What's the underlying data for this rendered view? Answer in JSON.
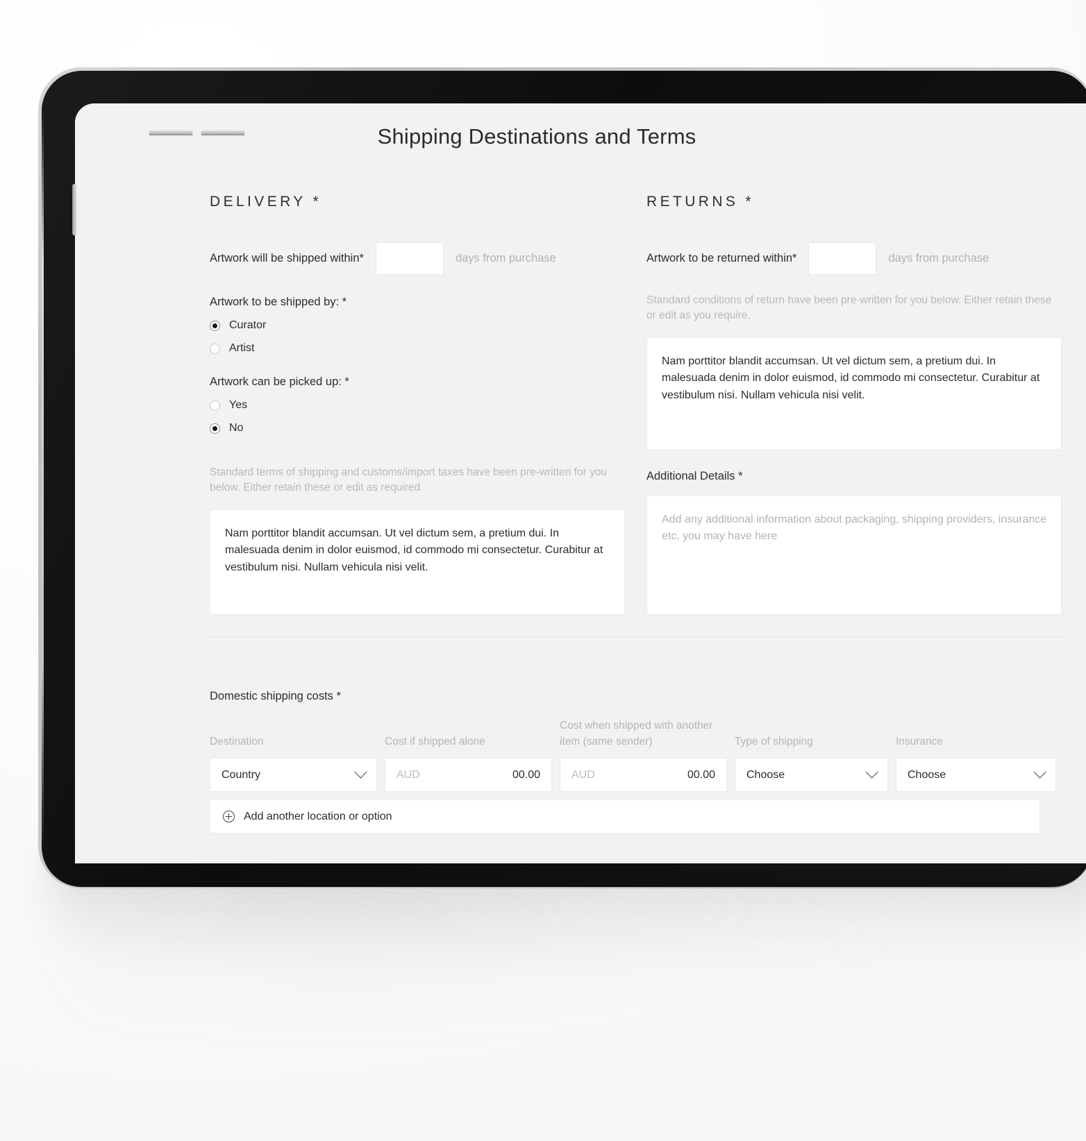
{
  "page": {
    "title": "Shipping Destinations and Terms"
  },
  "delivery": {
    "heading": "DELIVERY *",
    "shipped_within_label": "Artwork will be shipped within*",
    "shipped_within_value": "",
    "shipped_within_suffix": "days from purchase",
    "shipped_by_label": "Artwork to be shipped by: *",
    "shipped_by_options": [
      {
        "label": "Curator",
        "selected": true
      },
      {
        "label": "Artist",
        "selected": false
      }
    ],
    "picked_up_label": "Artwork can be picked up: *",
    "picked_up_options": [
      {
        "label": "Yes",
        "selected": false
      },
      {
        "label": "No",
        "selected": true
      }
    ],
    "terms_help": "Standard terms of shipping and customs/import taxes have been pre-written for you below. Either retain these or edit as required.",
    "terms_text": "Nam porttitor blandit accumsan. Ut vel dictum sem, a pretium dui. In malesuada denim in dolor euismod, id commodo mi consectetur. Curabitur at vestibulum nisi. Nullam vehicula nisi velit."
  },
  "returns": {
    "heading": "RETURNS *",
    "returned_within_label": "Artwork to be returned within*",
    "returned_within_value": "",
    "returned_within_suffix": "days from purchase",
    "conditions_help": "Standard conditions of return have been pre-written for you below. Either retain these or edit as you require.",
    "conditions_text": "Nam porttitor blandit accumsan. Ut vel dictum sem, a pretium dui. In malesuada denim in dolor euismod, id commodo mi consectetur. Curabitur at vestibulum nisi. Nullam vehicula nisi velit.",
    "additional_details_label": "Additional Details *",
    "additional_details_placeholder": "Add any additional information about packaging, shipping providers, insurance etc. you may have here"
  },
  "shipping_costs": {
    "title": "Domestic shipping costs *",
    "headers": [
      "Destination",
      "Cost if shipped alone",
      "Cost when shipped with another item (same sender)",
      "Type of shipping",
      "Insurance"
    ],
    "row": {
      "destination": "Country",
      "cost_alone_currency": "AUD",
      "cost_alone_amount": "00.00",
      "cost_with_other_currency": "AUD",
      "cost_with_other_amount": "00.00",
      "type_of_shipping": "Choose",
      "insurance": "Choose"
    },
    "add_button": "Add another location or option",
    "add_icon": "plus-circle-icon",
    "chevron_icon": "chevron-down-icon"
  },
  "colors": {
    "page_background": "#f2f2f2",
    "text": "#2c2c2c",
    "muted_text": "#b4b4b4",
    "field_background": "#ffffff",
    "field_border": "#e8e8e8",
    "device_bezel": "#121212"
  }
}
